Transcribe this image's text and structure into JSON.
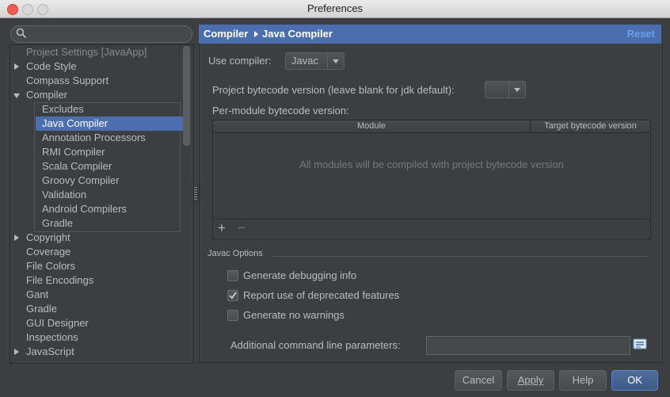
{
  "window": {
    "title": "Preferences"
  },
  "search": {
    "placeholder": "",
    "value": ""
  },
  "tree": {
    "section_label": "Project Settings [JavaApp]",
    "items": [
      {
        "label": "Code Style",
        "expander": "collapsed"
      },
      {
        "label": "Compass Support",
        "expander": "none"
      },
      {
        "label": "Compiler",
        "expander": "expanded"
      },
      {
        "label": "Excludes",
        "expander": "none"
      },
      {
        "label": "Java Compiler",
        "expander": "none",
        "selected": true
      },
      {
        "label": "Annotation Processors",
        "expander": "none"
      },
      {
        "label": "RMI Compiler",
        "expander": "none"
      },
      {
        "label": "Scala Compiler",
        "expander": "none"
      },
      {
        "label": "Groovy Compiler",
        "expander": "none"
      },
      {
        "label": "Validation",
        "expander": "none"
      },
      {
        "label": "Android Compilers",
        "expander": "none"
      },
      {
        "label": "Gradle",
        "expander": "none"
      },
      {
        "label": "Copyright",
        "expander": "collapsed"
      },
      {
        "label": "Coverage",
        "expander": "none"
      },
      {
        "label": "File Colors",
        "expander": "none"
      },
      {
        "label": "File Encodings",
        "expander": "none"
      },
      {
        "label": "Gant",
        "expander": "none"
      },
      {
        "label": "Gradle",
        "expander": "none"
      },
      {
        "label": "GUI Designer",
        "expander": "none"
      },
      {
        "label": "Inspections",
        "expander": "none"
      },
      {
        "label": "JavaScript",
        "expander": "collapsed"
      }
    ]
  },
  "header": {
    "crumb1": "Compiler",
    "crumb2": "Java Compiler",
    "reset": "Reset"
  },
  "form": {
    "use_compiler_label": "Use compiler:",
    "use_compiler_value": "Javac",
    "bytecode_label": "Project bytecode version (leave blank for jdk default):",
    "bytecode_value": "",
    "per_module_label": "Per-module bytecode version:",
    "table": {
      "col_module": "Module",
      "col_target": "Target bytecode version",
      "empty_text": "All modules will be compiled with project bytecode version",
      "add": "+",
      "remove": "−"
    },
    "javac_section": "Javac Options",
    "options": [
      {
        "label": "Generate debugging info",
        "checked": false
      },
      {
        "label": "Report use of deprecated features",
        "checked": true
      },
      {
        "label": "Generate no warnings",
        "checked": false
      }
    ],
    "params_label": "Additional command line parameters:",
    "params_value": ""
  },
  "buttons": {
    "cancel": "Cancel",
    "apply": "Apply",
    "help": "Help",
    "ok": "OK"
  },
  "colors": {
    "selection": "#4b6eaf",
    "background": "#3c3f41",
    "text": "#bbbbbb",
    "link": "#6aa0e8"
  }
}
